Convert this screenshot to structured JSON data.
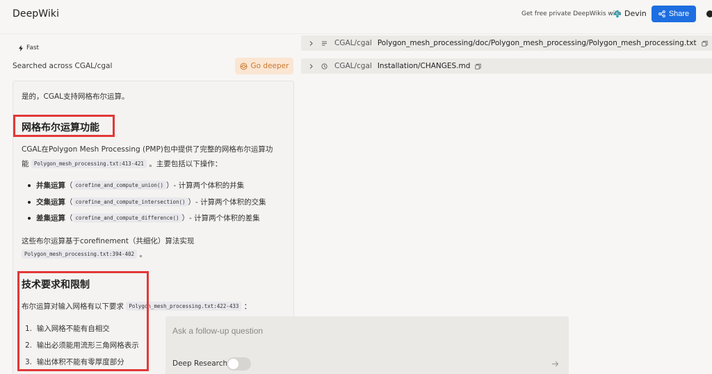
{
  "header": {
    "brand": "DeepWiki",
    "promo_text": "Get free private DeepWikis with",
    "devin_label": "Devin",
    "share_label": "Share"
  },
  "left_panel": {
    "badge": "Fast",
    "searched_text": "Searched across CGAL/cgal",
    "go_deeper_label": "Go deeper"
  },
  "answer": {
    "intro": "是的，CGAL支持网格布尔运算。",
    "section1_heading": "网格布尔运算功能",
    "p1_line1": "CGAL在Polygon Mesh Processing (PMP)包中提供了完整的网格布尔运算功",
    "p1_line2_prefix": "能",
    "p1_ref": "Polygon_mesh_processing.txt:413-421",
    "p1_line2_suffix": "。主要包括以下操作：",
    "ops": [
      {
        "name": "并集运算",
        "open": "（",
        "code": "corefine_and_compute_union()",
        "desc": "）- 计算两个体积的并集"
      },
      {
        "name": "交集运算",
        "open": "（",
        "code": "corefine_and_compute_intersection()",
        "desc": "）- 计算两个体积的交集"
      },
      {
        "name": "差集运算",
        "open": "（",
        "code": "corefine_and_compute_difference()",
        "desc": "）- 计算两个体积的差集"
      }
    ],
    "p2_line1": "这些布尔运算基于corefinement（共细化）算法实现",
    "p2_ref": "Polygon_mesh_processing.txt:394-402",
    "p2_suffix": "。",
    "section2_heading": "技术要求和限制",
    "p3_prefix": "布尔运算对输入网格有以下要求",
    "p3_ref": "Polygon_mesh_processing.txt:422-433",
    "p3_suffix": "：",
    "requirements": [
      {
        "num": "1.",
        "text": "输入网格不能有自相交"
      },
      {
        "num": "2.",
        "text": "输出必须能用流形三角网格表示"
      },
      {
        "num": "3.",
        "text": "输出体积不能有零厚度部分"
      }
    ]
  },
  "sources": [
    {
      "repo": "CGAL/cgal",
      "path": "Polygon_mesh_processing/doc/Polygon_mesh_processing/Polygon_mesh_processing.txt",
      "icon": "file-lines-icon"
    },
    {
      "repo": "CGAL/cgal",
      "path": "Installation/CHANGES.md",
      "icon": "clock-icon"
    }
  ],
  "followup": {
    "placeholder": "Ask a follow-up question",
    "deep_research_label": "Deep Research",
    "deep_research_on": false
  },
  "colors": {
    "share_bg": "#1d6ee0",
    "go_deeper_bg": "#fbe6d3",
    "go_deeper_fg": "#c9782f",
    "highlight_box": "#e23838",
    "devin_logo": "#1fa6b8"
  }
}
